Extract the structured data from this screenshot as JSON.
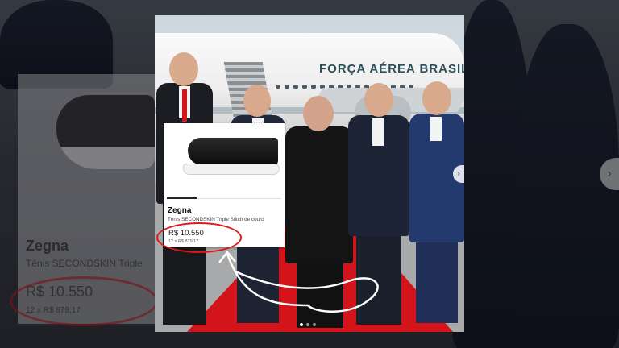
{
  "background": {
    "card": {
      "brand": "Zegna",
      "description": "Tênis SECONDSKIN Triple",
      "price": "R$ 10.550",
      "installments": "12 x R$ 879,17"
    },
    "next_icon": "chevron-right-icon"
  },
  "post": {
    "plane_title": "FORÇA AÉREA BRASIL",
    "product": {
      "brand": "Zegna",
      "description": "Tênis SECONDSKIN Triple Stitch de couro",
      "price": "R$ 10.550",
      "installments": "12 x R$ 879,17"
    },
    "carousel": {
      "next_icon": "chevron-right-icon",
      "total": 3,
      "active": 1
    },
    "annotation_color": "#e01717",
    "arrow_color": "#ffffff"
  }
}
